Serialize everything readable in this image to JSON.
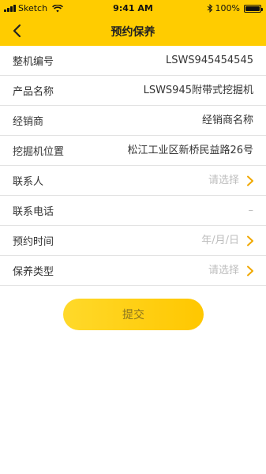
{
  "status": {
    "carrier": "Sketch",
    "time": "9:41 AM",
    "battery": "100%"
  },
  "nav": {
    "title": "预约保养"
  },
  "form": {
    "rows": [
      {
        "label": "整机编号",
        "value": "LSWS945454545"
      },
      {
        "label": "产品名称",
        "value": "LSWS945附带式挖掘机"
      },
      {
        "label": "经销商",
        "value": "经销商名称"
      },
      {
        "label": "挖掘机位置",
        "value": "松江工业区新桥民益路26号"
      },
      {
        "label": "联系人",
        "placeholder": "请选择"
      },
      {
        "label": "联系电话",
        "value": "–"
      },
      {
        "label": "预约时间",
        "placeholder": "年/月/日"
      },
      {
        "label": "保养类型",
        "placeholder": "请选择"
      }
    ]
  },
  "submit": {
    "label": "提交"
  },
  "colors": {
    "accent": "#ffcc00",
    "chevron": "#f0a800",
    "placeholder": "#bdbdbd"
  }
}
